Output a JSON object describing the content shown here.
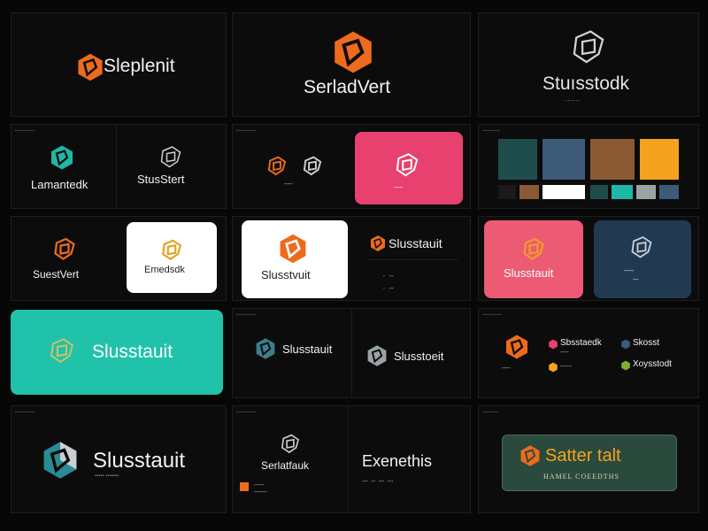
{
  "colors": {
    "orange": "#ee6a1c",
    "teal": "#1db9a6",
    "dark_teal": "#1f4d4c",
    "steel_blue": "#3d5a78",
    "brown": "#8a5a34",
    "amber": "#f4a21f",
    "pink": "#e8416f",
    "coral": "#ec5a74",
    "navy_card": "#213a52",
    "white": "#ffffff",
    "mint": "#20c3aa",
    "forest": "#2a4a3d",
    "grey": "#9aa3a3"
  },
  "tiles": {
    "t1": {
      "wordmark": "Sleplenit"
    },
    "t2": {
      "wordmark": "SerladVert"
    },
    "t3": {
      "wordmark": "Stuısstodk"
    },
    "t4": {
      "left": "Lamantedk",
      "right": "StusStert"
    },
    "t6": {
      "right": "Slusstauit"
    },
    "t7": {
      "left": "SuestVert",
      "card": "Emedsdk"
    },
    "t8": {
      "card": "Slusstvuit"
    },
    "t9": {
      "card": "Slusstauit"
    },
    "t10": {
      "left": "Slusstauit",
      "right": "Slusstoeit"
    },
    "t11": {
      "a": "Sbsstaedk",
      "b": "Skosst",
      "c": "Xoysstodt"
    },
    "t12": {
      "wordmark": "Slusstauit"
    },
    "t13": {
      "left": "Serlatfauk",
      "right": "Exenethis"
    },
    "t14": {
      "wordmark": "Satter talt",
      "tagline": "HAMEL COEEDTHS"
    }
  },
  "icons": [
    "logo-knot-icon"
  ]
}
